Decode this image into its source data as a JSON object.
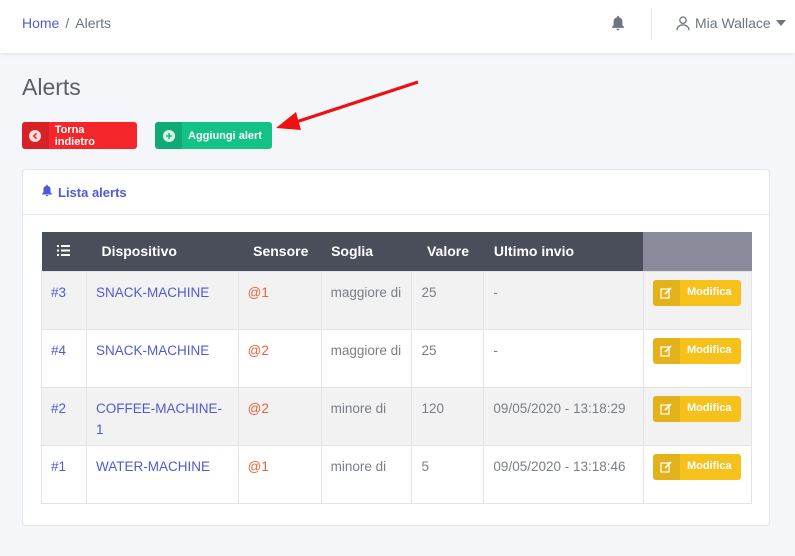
{
  "breadcrumb": {
    "home": "Home",
    "separator": "/",
    "current": "Alerts"
  },
  "user": {
    "name": "Mia Wallace"
  },
  "page": {
    "title": "Alerts"
  },
  "buttons": {
    "back": "Torna indietro",
    "add": "Aggiungi alert"
  },
  "card": {
    "title": "Lista alerts"
  },
  "table": {
    "headers": {
      "device": "Dispositivo",
      "sensor": "Sensore",
      "threshold": "Soglia",
      "value": "Valore",
      "last_sent": "Ultimo invio"
    },
    "edit_label": "Modifica",
    "rows": [
      {
        "id": "3",
        "device": "SNACK-MACHINE",
        "sensor": "1",
        "threshold": "maggiore di",
        "value": "25",
        "last_sent": "-"
      },
      {
        "id": "4",
        "device": "SNACK-MACHINE",
        "sensor": "2",
        "threshold": "maggiore di",
        "value": "25",
        "last_sent": "-"
      },
      {
        "id": "2",
        "device": "COFFEE-MACHINE-1",
        "sensor": "2",
        "threshold": "minore di",
        "value": "120",
        "last_sent": "09/05/2020 - 13:18:29"
      },
      {
        "id": "1",
        "device": "WATER-MACHINE",
        "sensor": "1",
        "threshold": "minore di",
        "value": "5",
        "last_sent": "09/05/2020 - 13:18:46"
      }
    ]
  },
  "colors": {
    "primary": "#4f5bd5",
    "danger": "#f5262a",
    "success": "#13c286",
    "warning": "#f7c11c",
    "sensor": "#e8643a"
  }
}
